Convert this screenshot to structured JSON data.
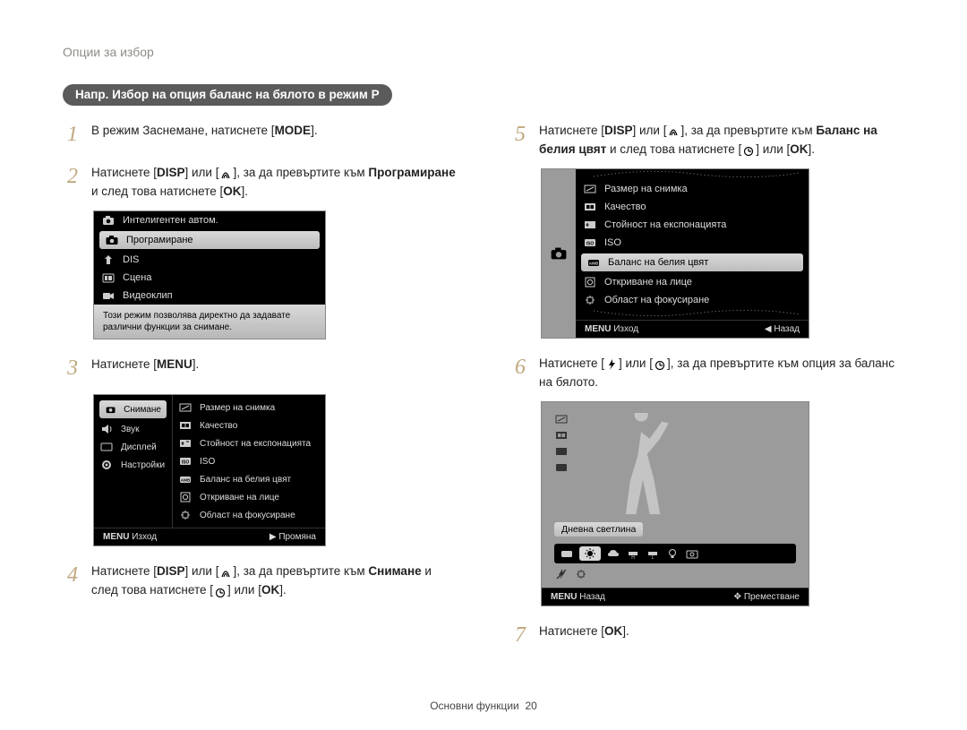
{
  "header": "Опции за избор",
  "pill": "Напр. Избор на опция баланс на бялото в режим P",
  "steps": {
    "1": "В режим Заснемане, натиснете [",
    "1b": "].",
    "2a": "Натиснете [",
    "2b": "] или [",
    "2c": "], за да превъртите към ",
    "2d": " и след това натиснете [",
    "2e": "].",
    "2_bold": "Програмиране",
    "3a": "Натиснете [",
    "3b": "].",
    "4a": "Натиснете [",
    "4b": "] или [",
    "4c": "], за да превъртите към ",
    "4_bold": "Снимане",
    "4d": " и след това натиснете [",
    "4e": "] или [",
    "4f": "].",
    "5a": "Натиснете [",
    "5b": "] или [",
    "5c": "], за да превъртите към ",
    "5_bold": "Баланс на белия цвят",
    "5d": " и след това натиснете [",
    "5e": "] или [",
    "5f": "].",
    "6a": "Натиснете [",
    "6b": "] или [",
    "6c": "], за да превъртите към опция за баланс на бялото.",
    "7a": "Натиснете [",
    "7b": "]."
  },
  "kbd": {
    "mode": "MODE",
    "disp": "DISP",
    "menu": "MENU",
    "ok": "OK"
  },
  "screen_mode": {
    "items": [
      "Интелигентен автом.",
      "Програмиране",
      "DIS",
      "Сцена",
      "Видеоклип"
    ],
    "desc": "Този режим позволява директно да задавате различни функции за снимане."
  },
  "screen_menu": {
    "left": [
      "Снимане",
      "Звук",
      "Дисплей",
      "Настройки"
    ],
    "right": [
      "Размер на снимка",
      "Качество",
      "Стойност на експонацията",
      "ISO",
      "Баланс на белия цвят",
      "Откриване на лице",
      "Област на фокусиране"
    ],
    "foot_l_label": "Изход",
    "foot_l_btn": "MENU",
    "foot_r_label": "Промяна",
    "foot_r_sym": "▶"
  },
  "screen_wb_list": {
    "items": [
      "Размер на снимка",
      "Качество",
      "Стойност на експонацията",
      "ISO",
      "Баланс на белия цвят",
      "Откриване на лице",
      "Област на фокусиране"
    ],
    "foot_l_label": "Изход",
    "foot_l_btn": "MENU",
    "foot_r_label": "Назад",
    "foot_r_sym": "◀"
  },
  "screen_wb_pick": {
    "label": "Дневна светлина",
    "foot_l_label": "Назад",
    "foot_l_btn": "MENU",
    "foot_r_label": "Преместване",
    "foot_r_sym": "✥"
  },
  "footer": {
    "label": "Основни функции",
    "page": "20"
  }
}
